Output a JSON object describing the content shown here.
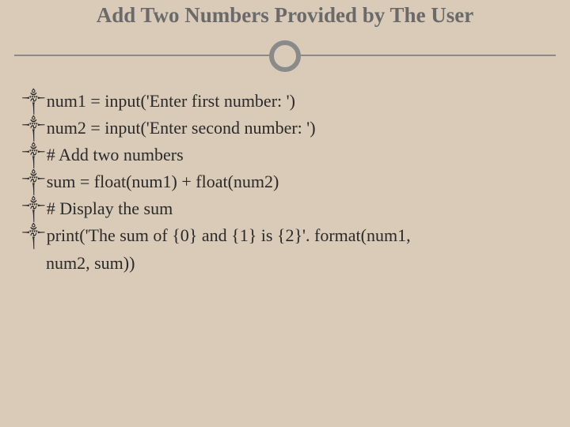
{
  "title": "Add Two Numbers Provided by The User",
  "bullet_glyph": "༒",
  "lines": {
    "l1": "num1 = input('Enter first number: ')",
    "l2": " num2 = input('Enter second number: ')",
    "l3": " # Add two numbers",
    "l4": "sum = float(num1) + float(num2)",
    "l5": " # Display the sum",
    "l6": "print('The sum of {0} and {1} is {2}'. format(num1,",
    "l6b": "num2, sum))"
  }
}
